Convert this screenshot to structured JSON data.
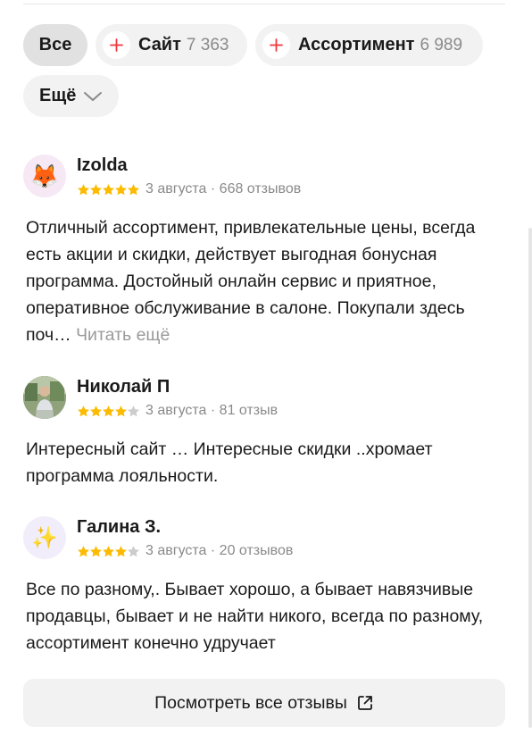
{
  "filters": {
    "all": "Все",
    "site": {
      "label": "Сайт",
      "count": "7 363"
    },
    "assortment": {
      "label": "Ассортимент",
      "count": "6 989"
    },
    "more": "Ещё"
  },
  "reviews": [
    {
      "author": "Izolda",
      "avatar_icon": "fox-emoji",
      "avatar_glyph": "🦊",
      "rating": 5,
      "meta": "3 августа · 668 отзывов",
      "text": "Отличный ассортимент, привлекательные цены, всегда есть акции и скидки, действует выгодная бонусная программа. Достойный онлайн сервис и приятное, оперативное обслуживание в салоне. Покупали здесь поч…",
      "read_more": "Читать ещё"
    },
    {
      "author": "Николай П",
      "avatar_icon": "user-photo",
      "rating": 4,
      "meta": "3 августа · 81 отзыв",
      "text": "Интересный сайт … Интересные скидки ..хромает программа лояльности."
    },
    {
      "author": "Галина З.",
      "avatar_icon": "sparkles-emoji",
      "avatar_glyph": "✨",
      "rating": 4,
      "meta": "3 августа · 20 отзывов",
      "text": "Все по разному,. Бывает хорошо, а бывает навязчивые продавцы, бывает и не найти никого, всегда по разному, ассортимент конечно удручает"
    }
  ],
  "all_reviews_button": "Посмотреть все отзывы",
  "colors": {
    "star": "#fcbb00",
    "star_empty": "#cccccc",
    "plus": "#f0383e"
  }
}
